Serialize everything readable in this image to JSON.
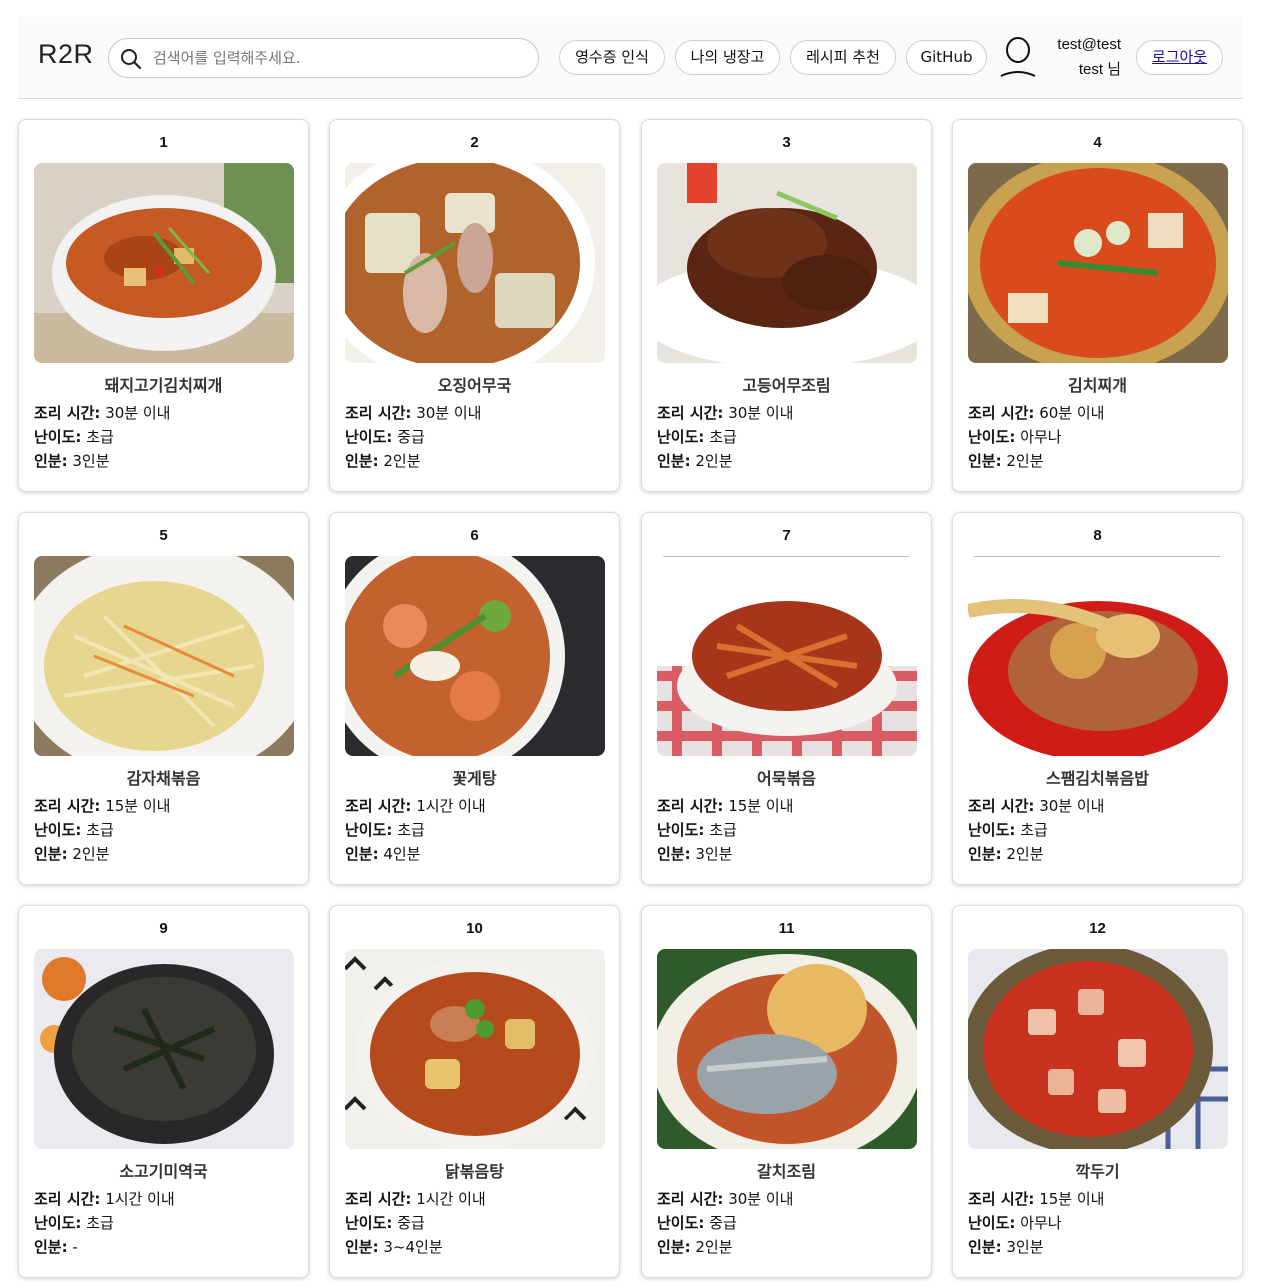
{
  "header": {
    "logo": "R2R",
    "search_placeholder": "검색어를 입력해주세요.",
    "nav": [
      "영수증 인식",
      "나의 냉장고",
      "레시피 추천",
      "GitHub"
    ],
    "user_email": "test@test",
    "user_name": "test 님",
    "logout_label": "로그아웃"
  },
  "labels": {
    "time": "조리 시간:",
    "difficulty": "난이도:",
    "servings": "인분:"
  },
  "recipes": [
    {
      "num": "1",
      "name": "돼지고기김치찌개",
      "time": "30분 이내",
      "difficulty": "초급",
      "servings": "3인분"
    },
    {
      "num": "2",
      "name": "오징어무국",
      "time": "30분 이내",
      "difficulty": "중급",
      "servings": "2인분"
    },
    {
      "num": "3",
      "name": "고등어무조림",
      "time": "30분 이내",
      "difficulty": "초급",
      "servings": "2인분"
    },
    {
      "num": "4",
      "name": "김치찌개",
      "time": "60분 이내",
      "difficulty": "아무나",
      "servings": "2인분"
    },
    {
      "num": "5",
      "name": "감자채볶음",
      "time": "15분 이내",
      "difficulty": "초급",
      "servings": "2인분"
    },
    {
      "num": "6",
      "name": "꽃게탕",
      "time": "1시간 이내",
      "difficulty": "초급",
      "servings": "4인분"
    },
    {
      "num": "7",
      "name": "어묵볶음",
      "time": "15분 이내",
      "difficulty": "초급",
      "servings": "3인분"
    },
    {
      "num": "8",
      "name": "스팸김치볶음밥",
      "time": "30분 이내",
      "difficulty": "초급",
      "servings": "2인분"
    },
    {
      "num": "9",
      "name": "소고기미역국",
      "time": "1시간 이내",
      "difficulty": "초급",
      "servings": "-"
    },
    {
      "num": "10",
      "name": "닭볶음탕",
      "time": "1시간 이내",
      "difficulty": "중급",
      "servings": "3~4인분"
    },
    {
      "num": "11",
      "name": "갈치조림",
      "time": "30분 이내",
      "difficulty": "중급",
      "servings": "2인분"
    },
    {
      "num": "12",
      "name": "깍두기",
      "time": "15분 이내",
      "difficulty": "아무나",
      "servings": "3인분"
    }
  ]
}
